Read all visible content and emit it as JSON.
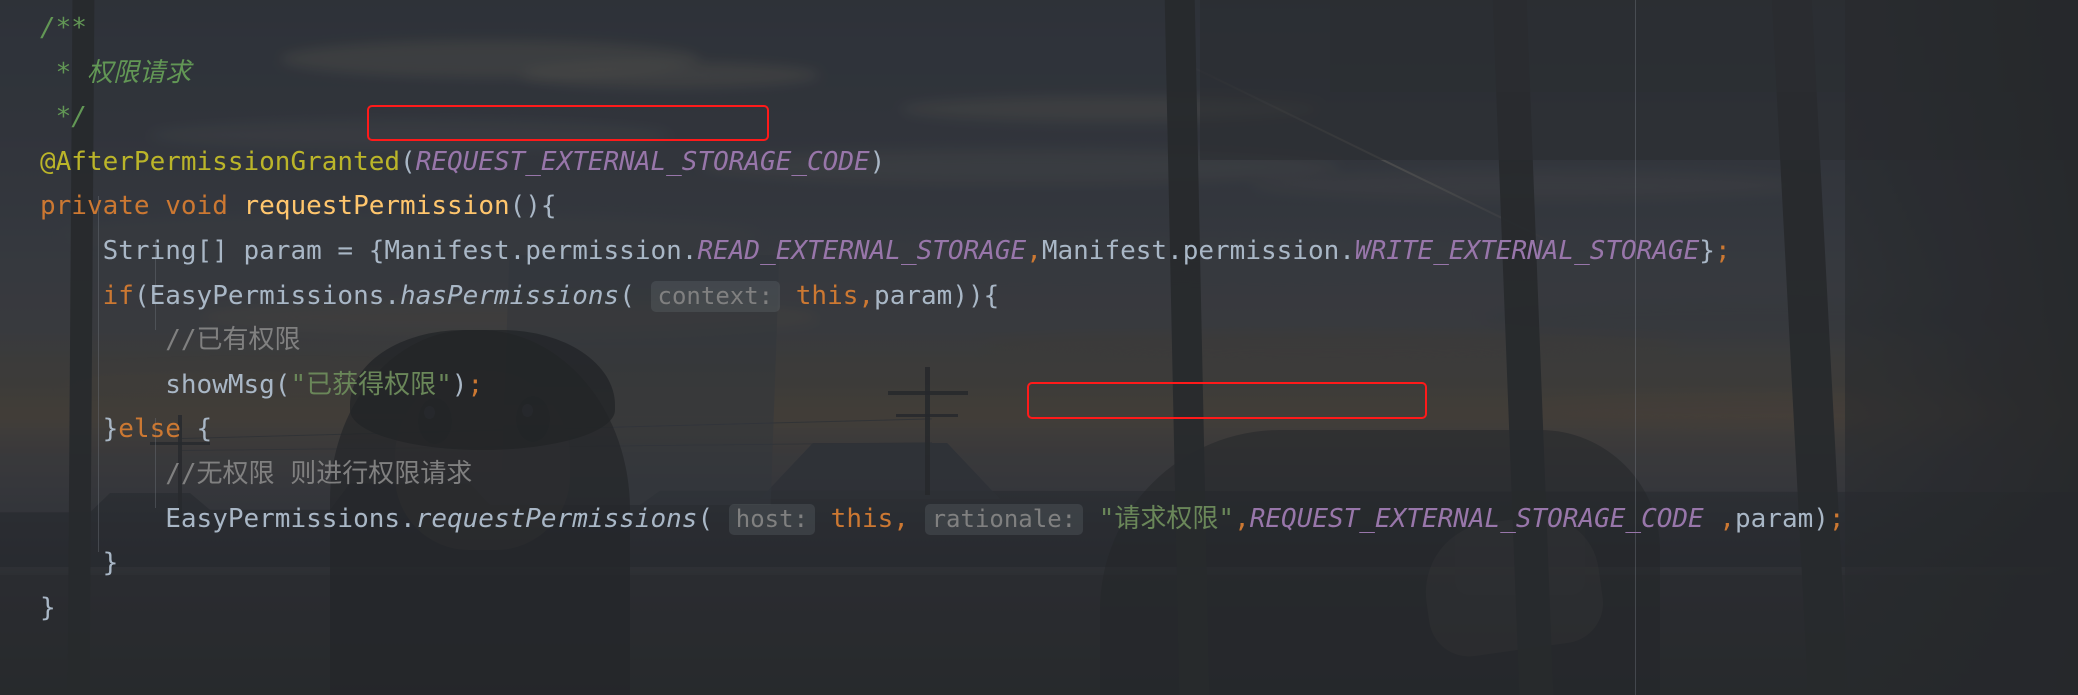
{
  "editor": {
    "app": "IntelliJ IDEA / Android Studio code editor",
    "theme": "Darcula dark with custom background image",
    "background_image_description": "anime illustration of a girl by a window at dusk with a cloudy sunset sky and utility poles",
    "colors": {
      "editor_bg": "#2b2b2b",
      "default_text": "#a9b7c6",
      "keyword": "#cc7832",
      "method": "#ffc66d",
      "annotation": "#bbb529",
      "static_field": "#9876aa",
      "string": "#6a8759",
      "block_comment": "#629755",
      "line_comment": "#808080",
      "param_hint": "#808080",
      "annotation_box": "#ff1a1a"
    }
  },
  "code": {
    "language": "Java",
    "lines": [
      {
        "n": 1,
        "indent": 0,
        "tokens": [
          {
            "t": "/**",
            "k": "cmt"
          }
        ]
      },
      {
        "n": 2,
        "indent": 0,
        "tokens": [
          {
            "t": " * 权限请求",
            "k": "cmt"
          }
        ]
      },
      {
        "n": 3,
        "indent": 0,
        "tokens": [
          {
            "t": " */",
            "k": "cmt"
          }
        ]
      },
      {
        "n": 4,
        "indent": 0,
        "tokens": [
          {
            "t": "@AfterPermissionGranted",
            "k": "ann"
          },
          {
            "t": "(",
            "k": "txt"
          },
          {
            "t": "REQUEST_EXTERNAL_STORAGE_CODE",
            "k": "stat"
          },
          {
            "t": ")",
            "k": "txt"
          }
        ]
      },
      {
        "n": 5,
        "indent": 0,
        "tokens": [
          {
            "t": "private",
            "k": "kw"
          },
          {
            "t": " ",
            "k": "txt"
          },
          {
            "t": "void",
            "k": "kw"
          },
          {
            "t": " ",
            "k": "txt"
          },
          {
            "t": "requestPermission",
            "k": "meth"
          },
          {
            "t": "(){",
            "k": "txt"
          }
        ]
      },
      {
        "n": 6,
        "indent": 1,
        "tokens": [
          {
            "t": "String[] param = {Manifest.permission.",
            "k": "txt"
          },
          {
            "t": "READ_EXTERNAL_STORAGE",
            "k": "stat"
          },
          {
            "t": ",",
            "k": "sep"
          },
          {
            "t": "Manifest.permission.",
            "k": "txt"
          },
          {
            "t": "WRITE_EXTERNAL_STORAGE",
            "k": "stat"
          },
          {
            "t": "}",
            "k": "txt"
          },
          {
            "t": ";",
            "k": "sep"
          }
        ]
      },
      {
        "n": 7,
        "indent": 1,
        "tokens": [
          {
            "t": "if",
            "k": "kw"
          },
          {
            "t": "(EasyPermissions.",
            "k": "txt"
          },
          {
            "t": "hasPermissions",
            "k": "statfn"
          },
          {
            "t": "(",
            "k": "txt"
          },
          {
            "t": " ",
            "k": "txt"
          },
          {
            "t": "context:",
            "k": "hint"
          },
          {
            "t": " ",
            "k": "txt"
          },
          {
            "t": "this",
            "k": "kw"
          },
          {
            "t": ",",
            "k": "sep"
          },
          {
            "t": "param)){",
            "k": "txt"
          }
        ]
      },
      {
        "n": 8,
        "indent": 2,
        "tokens": [
          {
            "t": "//已有权限",
            "k": "cmt-line"
          }
        ]
      },
      {
        "n": 9,
        "indent": 2,
        "tokens": [
          {
            "t": "showMsg(",
            "k": "txt"
          },
          {
            "t": "\"已获得权限\"",
            "k": "str"
          },
          {
            "t": ")",
            "k": "txt"
          },
          {
            "t": ";",
            "k": "sep"
          }
        ]
      },
      {
        "n": 10,
        "indent": 1,
        "tokens": [
          {
            "t": "}",
            "k": "txt"
          },
          {
            "t": "else",
            "k": "kw"
          },
          {
            "t": " {",
            "k": "txt"
          }
        ]
      },
      {
        "n": 11,
        "indent": 2,
        "tokens": [
          {
            "t": "//无权限 则进行权限请求",
            "k": "cmt-line"
          }
        ]
      },
      {
        "n": 12,
        "indent": 2,
        "tokens": [
          {
            "t": "EasyPermissions.",
            "k": "txt"
          },
          {
            "t": "requestPermissions",
            "k": "statfn"
          },
          {
            "t": "(",
            "k": "txt"
          },
          {
            "t": " ",
            "k": "txt"
          },
          {
            "t": "host:",
            "k": "hint"
          },
          {
            "t": " ",
            "k": "txt"
          },
          {
            "t": "this",
            "k": "kw"
          },
          {
            "t": ",",
            "k": "sep"
          },
          {
            "t": " ",
            "k": "txt"
          },
          {
            "t": "rationale:",
            "k": "hint"
          },
          {
            "t": " ",
            "k": "txt"
          },
          {
            "t": "\"请求权限\"",
            "k": "str"
          },
          {
            "t": ",",
            "k": "sep"
          },
          {
            "t": "REQUEST_EXTERNAL_STORAGE_CODE",
            "k": "stat"
          },
          {
            "t": " ,",
            "k": "sep"
          },
          {
            "t": "param)",
            "k": "txt"
          },
          {
            "t": ";",
            "k": "sep"
          }
        ]
      },
      {
        "n": 13,
        "indent": 1,
        "tokens": [
          {
            "t": "}",
            "k": "txt"
          }
        ]
      },
      {
        "n": 14,
        "indent": 0,
        "tokens": [
          {
            "t": "}",
            "k": "txt"
          }
        ]
      }
    ]
  },
  "annotations": {
    "boxes": [
      {
        "id": "redbox-1",
        "label": "REQUEST_EXTERNAL_STORAGE_CODE",
        "color": "#ff1a1a"
      },
      {
        "id": "redbox-2",
        "label": "REQUEST_EXTERNAL_STORAGE_CODE",
        "color": "#ff1a1a"
      }
    ]
  },
  "parameter_hints": [
    "context:",
    "host:",
    "rationale:"
  ]
}
